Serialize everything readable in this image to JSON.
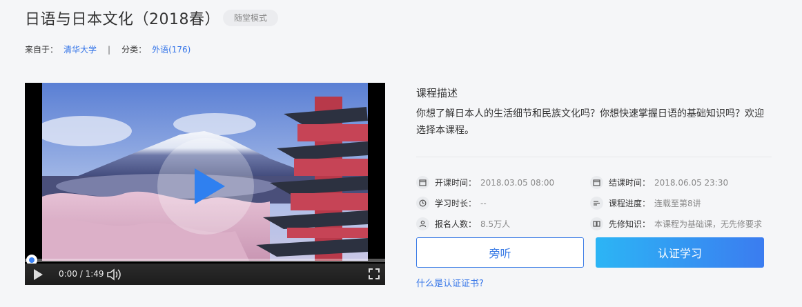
{
  "course": {
    "title": "日语与日本文化（2018春）",
    "mode_tag": "随堂模式"
  },
  "meta": {
    "source_label": "来自于：",
    "source_value": "清华大学",
    "separator": "|",
    "category_label": "分类：",
    "category_value": "外语(176)"
  },
  "video": {
    "time_display": "0:00 / 1:49",
    "progress": 0
  },
  "description": {
    "title": "课程描述",
    "text": "你想了解日本人的生活细节和民族文化吗？你想快速掌握日语的基础知识吗？欢迎选择本课程。"
  },
  "info": {
    "start": {
      "label": "开课时间：",
      "value": "2018.03.05 08:00",
      "icon": "calendar-icon"
    },
    "end": {
      "label": "结课时间：",
      "value": "2018.06.05 23:30",
      "icon": "calendar-icon"
    },
    "duration": {
      "label": "学习时长：",
      "value": "--",
      "icon": "clock-icon"
    },
    "progress": {
      "label": "课程进度：",
      "value": "连载至第8讲",
      "icon": "list-icon"
    },
    "enrolled": {
      "label": "报名人数：",
      "value": "8.5万人",
      "icon": "user-icon"
    },
    "prereq": {
      "label": "先修知识：",
      "value": "本课程为基础课，无先修要求",
      "icon": "book-icon"
    }
  },
  "buttons": {
    "audit": "旁听",
    "certified": "认证学习"
  },
  "cert_link": "什么是认证证书?",
  "colors": {
    "accent": "#3b7ce6",
    "gradient_start": "#2cb5f5",
    "gradient_end": "#3b7cf0",
    "background": "#f5f6f8"
  }
}
